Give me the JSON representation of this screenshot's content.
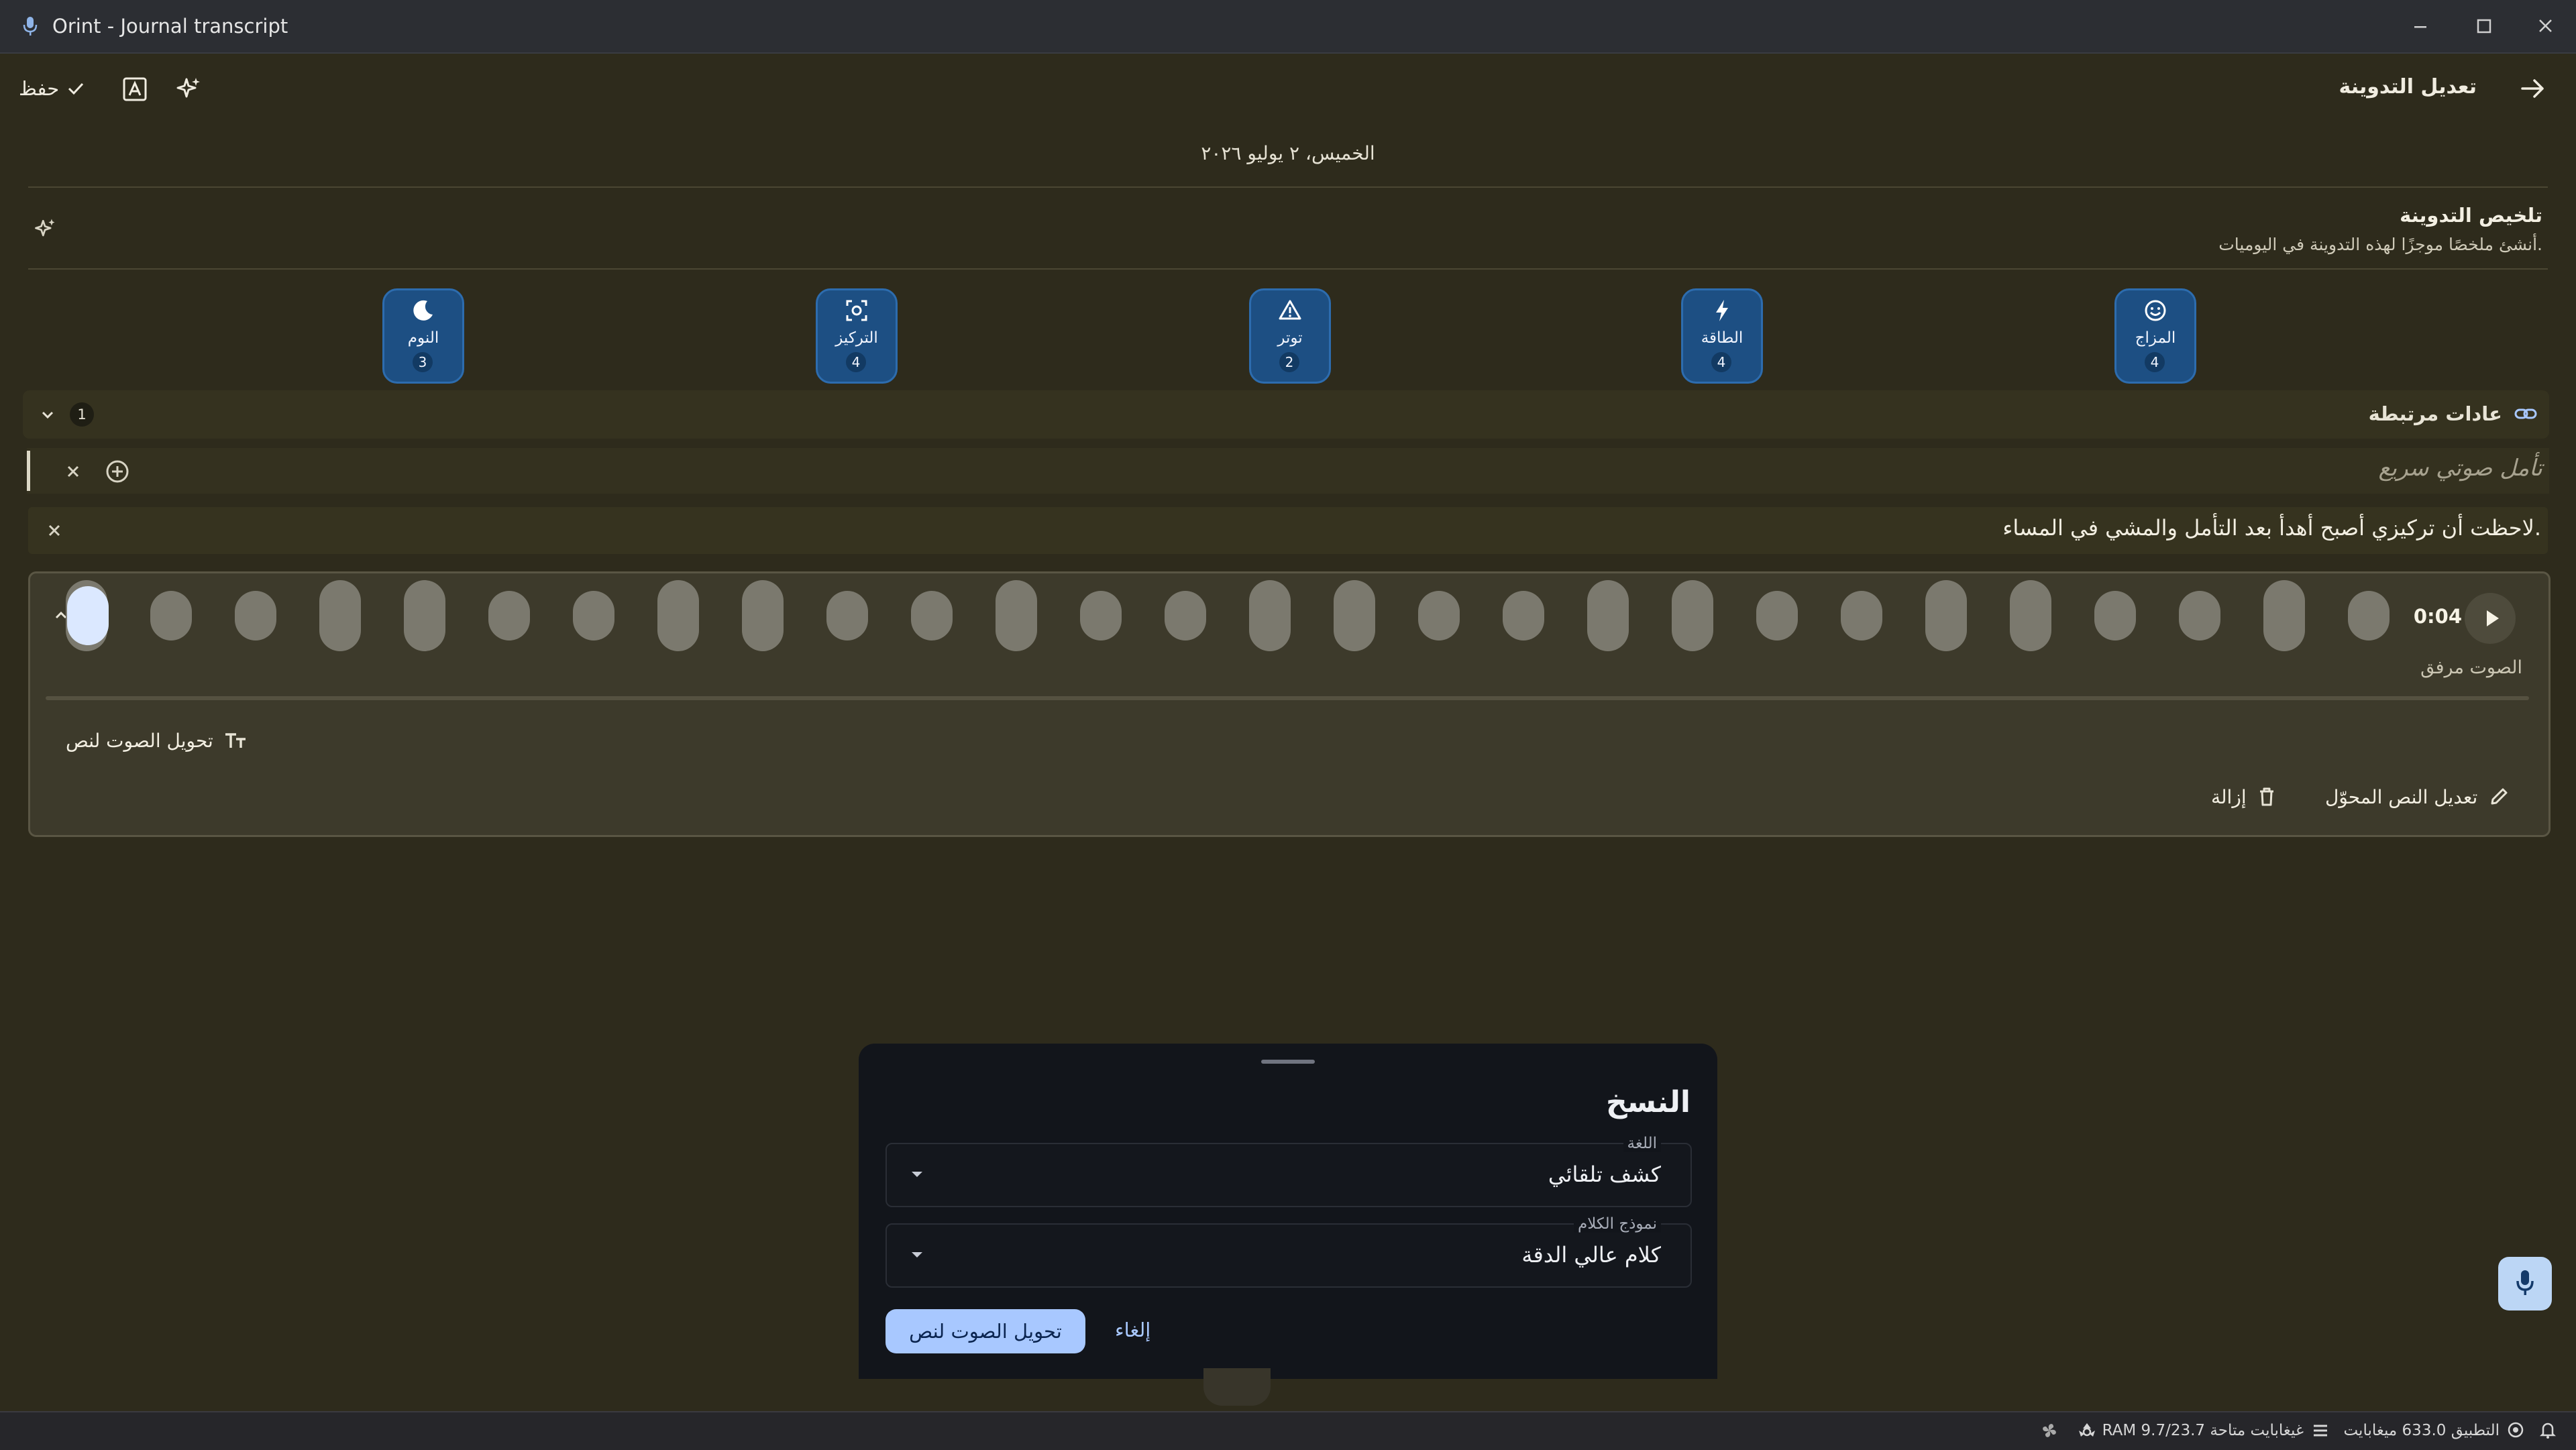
{
  "window": {
    "title": "Orint - Journal transcript"
  },
  "appbar": {
    "title": "تعديل التدوينة",
    "save_label": "حفظ"
  },
  "entry": {
    "date": "الخميس، ٢ يوليو ٢٠٢٦"
  },
  "summary": {
    "title": "تلخيص التدوينة",
    "subtitle": "أنشئ ملخصًا موجزًا لهذه التدوينة في اليوميات."
  },
  "metrics": [
    {
      "label": "المزاج",
      "value": "4",
      "icon": "smile-icon"
    },
    {
      "label": "الطاقة",
      "value": "4",
      "icon": "bolt-icon"
    },
    {
      "label": "توتر",
      "value": "2",
      "icon": "warning-icon"
    },
    {
      "label": "التركيز",
      "value": "4",
      "icon": "focus-icon"
    },
    {
      "label": "النوم",
      "value": "3",
      "icon": "moon-icon"
    }
  ],
  "habits": {
    "title": "عادات مرتبطة",
    "count": "1"
  },
  "quick_reflection": {
    "placeholder": "تأمل صوتي سريع"
  },
  "note": {
    "text": "لاحظت أن تركيزي أصبح أهدأ بعد التأمل والمشي في المساء."
  },
  "audio": {
    "duration": "0:04",
    "label": "الصوت مرفق",
    "transcribe_label": "تحويل الصوت لنص",
    "edit_label": "تعديل النص المحوّل",
    "remove_label": "إزالة"
  },
  "sheet": {
    "title": "النسخ",
    "language": {
      "label": "اللغة",
      "value": "كشف تلقائي"
    },
    "model": {
      "label": "نموذج الكلام",
      "value": "كلام عالي الدقة"
    },
    "confirm_label": "تحويل الصوت لنص",
    "cancel_label": "إلغاء"
  },
  "status": {
    "app_memory": "التطبيق 633.0 ميغابايت",
    "ram": "RAM 9.7/23.7 غيغابايت متاحة"
  },
  "colors": {
    "background": "#2e2b1c",
    "metric_chip": "#1d4f83",
    "accent": "#a8c8ff",
    "sheet": "#12151b"
  }
}
